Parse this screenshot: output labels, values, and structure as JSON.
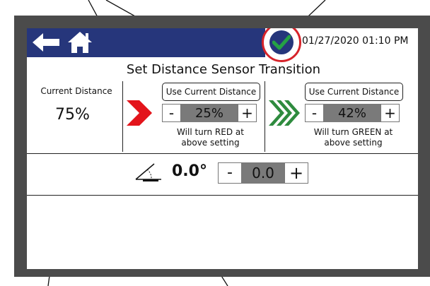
{
  "header": {
    "datetime": "01/27/2020 01:10 PM"
  },
  "page": {
    "title": "Set Distance Sensor Transition"
  },
  "current_distance": {
    "label": "Current Distance",
    "value": "75%"
  },
  "red_transition": {
    "button_label": "Use Current Distance",
    "minus": "-",
    "value": "25%",
    "plus": "+",
    "note_line1": "Will turn RED at",
    "note_line2": "above setting"
  },
  "green_transition": {
    "button_label": "Use Current Distance",
    "minus": "-",
    "value": "42%",
    "plus": "+",
    "note_line1": "Will turn GREEN at",
    "note_line2": "above setting"
  },
  "angle": {
    "value": "0.0°",
    "minus": "-",
    "setting": "0.0",
    "plus": "+"
  },
  "colors": {
    "header_blue": "#26367b",
    "status_red_ring": "#d6232a",
    "check_green": "#25a244",
    "red_chevron": "#e3141b",
    "green_chevron": "#2e8b3e",
    "bezel_gray": "#4b4b4b"
  }
}
